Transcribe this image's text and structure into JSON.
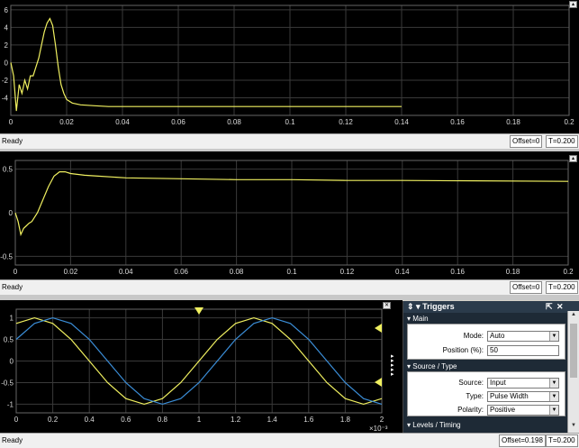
{
  "colors": {
    "trace_yellow": "#f0f060",
    "trace_blue": "#3b8ed8",
    "grid": "#3a3a3a",
    "background": "#000000"
  },
  "scope1": {
    "status": "Ready",
    "offset": "Offset=0",
    "time": "T=0.200",
    "y_ticks": [
      "6",
      "4",
      "2",
      "0",
      "-2",
      "-4"
    ],
    "x_ticks": [
      "0",
      "0.02",
      "0.04",
      "0.06",
      "0.08",
      "0.1",
      "0.12",
      "0.14",
      "0.16",
      "0.18",
      "0.2"
    ]
  },
  "scope2": {
    "status": "Ready",
    "offset": "Offset=0",
    "time": "T=0.200",
    "y_ticks": [
      "0.5",
      "0",
      "-0.5"
    ],
    "x_ticks": [
      "0",
      "0.02",
      "0.04",
      "0.06",
      "0.08",
      "0.1",
      "0.12",
      "0.14",
      "0.16",
      "0.18",
      "0.2"
    ]
  },
  "scope3": {
    "status": "Ready",
    "offset": "Offset=0.198",
    "time": "T=0.200",
    "y_ticks": [
      "1",
      "0.5",
      "0",
      "-0.5",
      "-1"
    ],
    "x_ticks": [
      "0",
      "0.2",
      "0.4",
      "0.6",
      "0.8",
      "1",
      "1.2",
      "1.4",
      "1.6",
      "1.8",
      "2"
    ],
    "x_multiplier": "×10⁻³"
  },
  "triggers": {
    "title": "Triggers",
    "main_section": "Main",
    "mode_label": "Mode:",
    "mode_value": "Auto",
    "position_label": "Position (%):",
    "position_value": "50",
    "source_section": "Source / Type",
    "source_label": "Source:",
    "source_value": "Input",
    "type_label": "Type:",
    "type_value": "Pulse Width",
    "polarity_label": "Polarity:",
    "polarity_value": "Positive",
    "levels_section": "Levels / Timing"
  },
  "chart_data": [
    {
      "type": "line",
      "title": "",
      "xlim": [
        0,
        0.2
      ],
      "ylim": [
        -6,
        6.5
      ],
      "series": [
        {
          "x": [
            0,
            0.001,
            0.002,
            0.003,
            0.004,
            0.005,
            0.006,
            0.007,
            0.008,
            0.009,
            0.01,
            0.011,
            0.012,
            0.013,
            0.014,
            0.015,
            0.016,
            0.017,
            0.018,
            0.019,
            0.02,
            0.022,
            0.025,
            0.03,
            0.035,
            0.04,
            0.06,
            0.08,
            0.1,
            0.12,
            0.14
          ],
          "y": [
            0,
            -1.5,
            -5.5,
            -2.5,
            -3.5,
            -2,
            -3,
            -1.5,
            -1.5,
            -0.5,
            0.5,
            2,
            3.5,
            4.5,
            5,
            4.2,
            2,
            -0.5,
            -2.5,
            -3.5,
            -4.2,
            -4.6,
            -4.8,
            -4.9,
            -5,
            -5,
            -5,
            -5,
            -5,
            -5,
            -5
          ]
        }
      ]
    },
    {
      "type": "line",
      "title": "",
      "xlim": [
        0,
        0.2
      ],
      "ylim": [
        -0.6,
        0.6
      ],
      "series": [
        {
          "x": [
            0,
            0.001,
            0.002,
            0.003,
            0.004,
            0.005,
            0.006,
            0.007,
            0.008,
            0.01,
            0.012,
            0.014,
            0.016,
            0.018,
            0.02,
            0.025,
            0.03,
            0.04,
            0.06,
            0.08,
            0.1,
            0.12,
            0.14,
            0.2
          ],
          "y": [
            0,
            -0.1,
            -0.25,
            -0.18,
            -0.15,
            -0.12,
            -0.1,
            -0.05,
            0,
            0.15,
            0.3,
            0.42,
            0.47,
            0.47,
            0.45,
            0.43,
            0.42,
            0.4,
            0.39,
            0.38,
            0.38,
            0.37,
            0.37,
            0.36
          ]
        }
      ]
    },
    {
      "type": "line",
      "title": "",
      "xlim": [
        0,
        2
      ],
      "ylim": [
        -1.2,
        1.2
      ],
      "x_unit_multiplier": "1e-3",
      "series": [
        {
          "color": "#f0f060",
          "x": [
            0,
            0.1,
            0.2,
            0.3,
            0.4,
            0.5,
            0.6,
            0.7,
            0.8,
            0.9,
            1.0,
            1.1,
            1.2,
            1.3,
            1.4,
            1.5,
            1.6,
            1.7,
            1.8,
            1.9,
            2.0
          ],
          "y": [
            0.87,
            1.0,
            0.87,
            0.5,
            0.0,
            -0.5,
            -0.87,
            -1.0,
            -0.87,
            -0.5,
            0.0,
            0.5,
            0.87,
            1.0,
            0.87,
            0.5,
            0.0,
            -0.5,
            -0.87,
            -1.0,
            -0.87
          ]
        },
        {
          "color": "#3b8ed8",
          "x": [
            0,
            0.1,
            0.2,
            0.3,
            0.4,
            0.5,
            0.6,
            0.7,
            0.8,
            0.9,
            1.0,
            1.1,
            1.2,
            1.3,
            1.4,
            1.5,
            1.6,
            1.7,
            1.8,
            1.9,
            2.0
          ],
          "y": [
            0.5,
            0.87,
            1.0,
            0.87,
            0.5,
            0.0,
            -0.5,
            -0.87,
            -1.0,
            -0.87,
            -0.5,
            0.0,
            0.5,
            0.87,
            1.0,
            0.87,
            0.5,
            0.0,
            -0.5,
            -0.87,
            -1.0
          ]
        }
      ]
    }
  ]
}
